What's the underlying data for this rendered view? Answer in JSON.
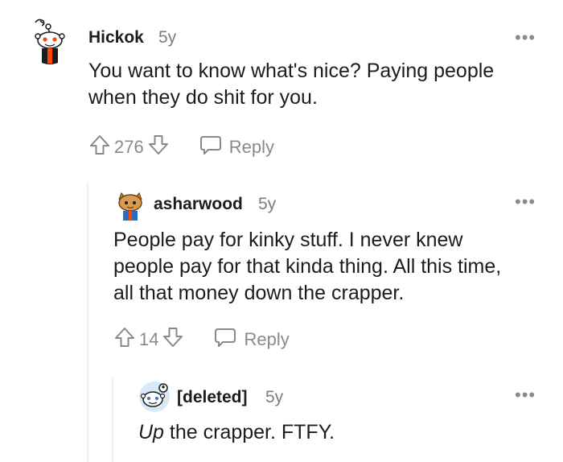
{
  "comments": [
    {
      "username": "Hickok",
      "age": "5y",
      "text_lines": [
        "You want to know what's nice? Paying people",
        "when they do shit for you."
      ],
      "score": "276",
      "reply_label": "Reply",
      "menu": "•••",
      "avatar_icon": "snoo-avatar-icon"
    },
    {
      "username": "asharwood",
      "age": "5y",
      "text_lines": [
        "People pay for kinky stuff. I never knew",
        "people pay for that kinda thing. All this time,",
        "all that money down the crapper."
      ],
      "score": "14",
      "reply_label": "Reply",
      "menu": "•••",
      "avatar_icon": "snoo-avatar-icon"
    },
    {
      "username": "[deleted]",
      "age": "5y",
      "text_italic": "Up",
      "text_rest": " the crapper. FTFY.",
      "menu": "•••",
      "avatar_icon": "snoo-avatar-icon"
    }
  ],
  "colors": {
    "text": "#1c1c1c",
    "meta": "#7c7c7c",
    "icon": "#878a8c",
    "thread_line": "#edeff1",
    "snoo_orange": "#ff4500"
  }
}
